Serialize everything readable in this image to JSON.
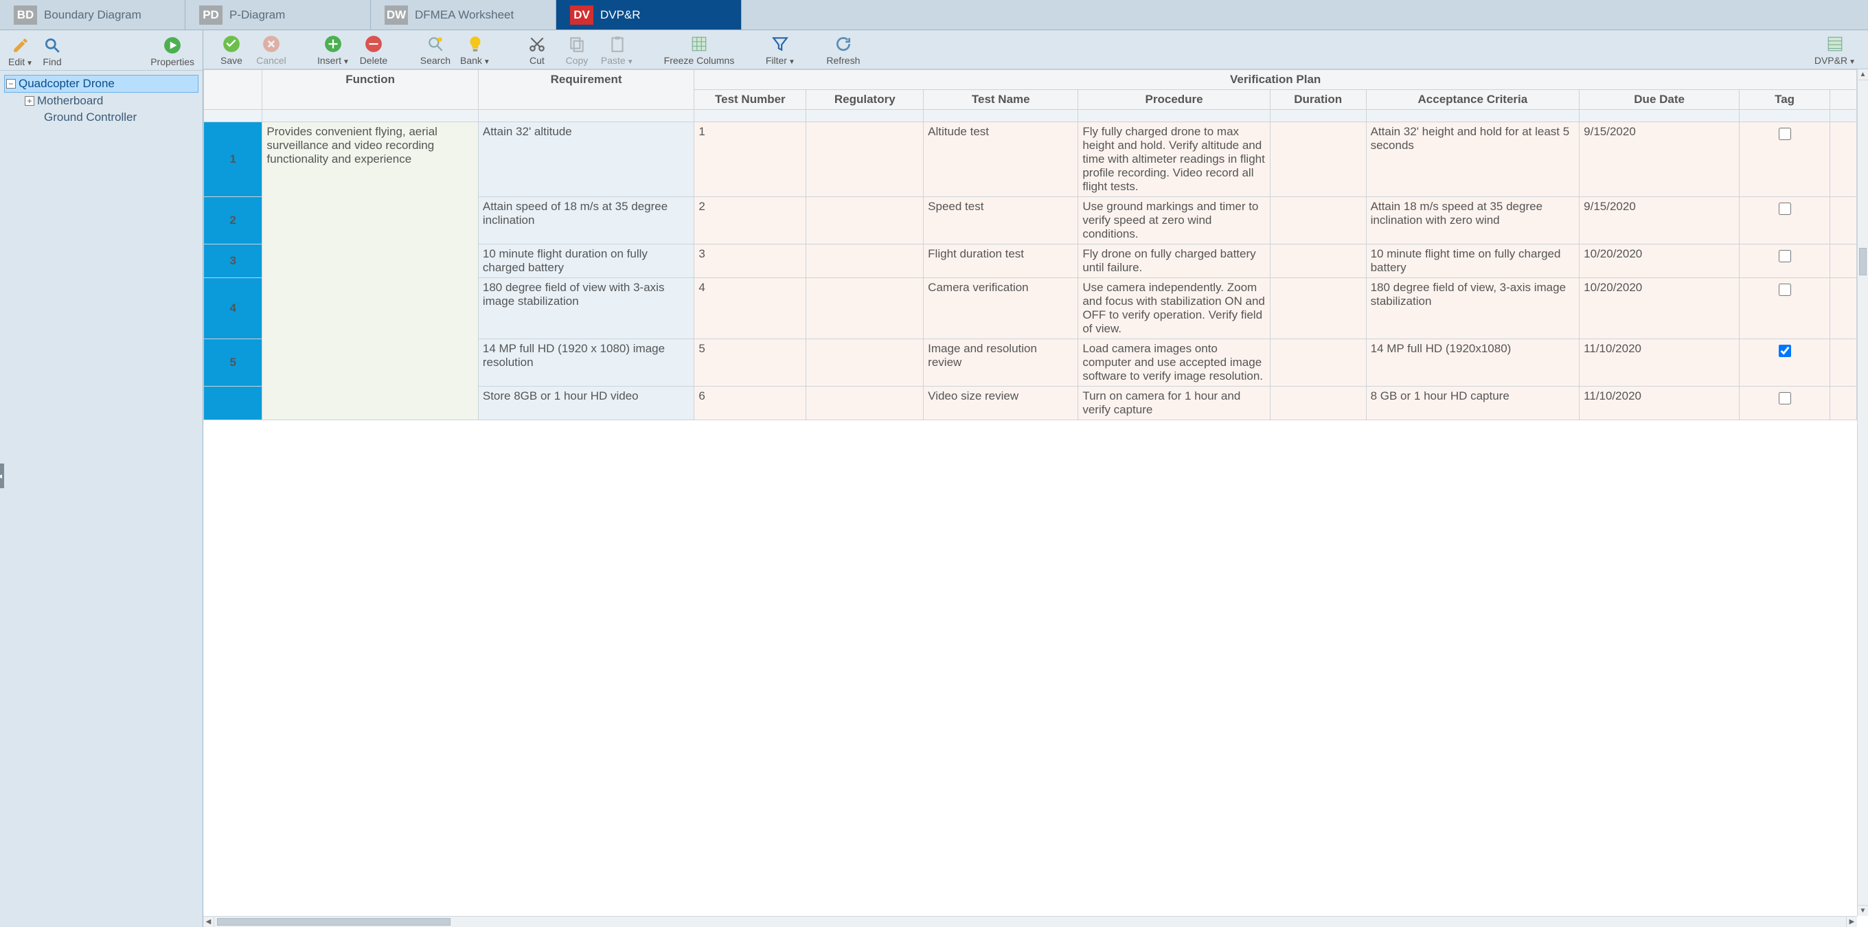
{
  "tabs": [
    {
      "badge": "BD",
      "label": "Boundary Diagram"
    },
    {
      "badge": "PD",
      "label": "P-Diagram"
    },
    {
      "badge": "DW",
      "label": "DFMEA Worksheet"
    },
    {
      "badge": "DV",
      "label": "DVP&R"
    }
  ],
  "leftToolbar": {
    "edit": "Edit",
    "find": "Find",
    "properties": "Properties"
  },
  "tree": {
    "root": "Quadcopter Drone",
    "child1": "Motherboard",
    "child2": "Ground Controller"
  },
  "rightToolbar": {
    "save": "Save",
    "cancel": "Cancel",
    "insert": "Insert",
    "delete": "Delete",
    "search": "Search",
    "bank": "Bank",
    "cut": "Cut",
    "copy": "Copy",
    "paste": "Paste",
    "freeze": "Freeze Columns",
    "filter": "Filter",
    "refresh": "Refresh",
    "dvpr": "DVP&R"
  },
  "headers": {
    "function": "Function",
    "requirement": "Requirement",
    "verification": "Verification Plan",
    "testNumber": "Test Number",
    "regulatory": "Regulatory",
    "testName": "Test Name",
    "procedure": "Procedure",
    "duration": "Duration",
    "acceptance": "Acceptance Criteria",
    "dueDate": "Due Date",
    "tag": "Tag"
  },
  "rows": [
    {
      "num": "1",
      "func": "Provides convenient flying, aerial surveillance and video recording functionality and experience",
      "req": "Attain 32' altitude",
      "tnum": "1",
      "reg": "",
      "tname": "Altitude test",
      "proc": "Fly fully charged drone to max height and hold. Verify altitude and time with altimeter readings in flight profile recording. Video record all flight tests.",
      "dur": "",
      "acc": "Attain 32' height and hold for at least 5 seconds",
      "due": "9/15/2020",
      "tag": false
    },
    {
      "num": "2",
      "func": "",
      "req": "Attain speed of 18 m/s at 35 degree inclination",
      "tnum": "2",
      "reg": "",
      "tname": "Speed test",
      "proc": "Use ground markings and timer to verify speed at zero wind conditions.",
      "dur": "",
      "acc": "Attain 18 m/s speed at 35 degree inclination with zero wind",
      "due": "9/15/2020",
      "tag": false
    },
    {
      "num": "3",
      "func": "",
      "req": "10 minute flight duration on fully charged battery",
      "tnum": "3",
      "reg": "",
      "tname": "Flight duration test",
      "proc": "Fly drone on fully charged battery until failure.",
      "dur": "",
      "acc": "10 minute flight time on fully charged battery",
      "due": "10/20/2020",
      "tag": false
    },
    {
      "num": "4",
      "func": "",
      "req": "180 degree field of view with 3-axis image stabilization",
      "tnum": "4",
      "reg": "",
      "tname": "Camera verification",
      "proc": "Use camera independently. Zoom and focus with stabilization ON and OFF to verify operation. Verify field of view.",
      "dur": "",
      "acc": "180 degree field of view, 3-axis image stabilization",
      "due": "10/20/2020",
      "tag": false
    },
    {
      "num": "5",
      "func": "",
      "req": "14 MP full HD (1920 x 1080) image resolution",
      "tnum": "5",
      "reg": "",
      "tname": "Image and resolution review",
      "proc": "Load camera images onto computer and use accepted image software to verify image resolution.",
      "dur": "",
      "acc": "14 MP full HD (1920x1080)",
      "due": "11/10/2020",
      "tag": true
    },
    {
      "num": "",
      "func": "",
      "req": "Store 8GB or 1 hour HD video",
      "tnum": "6",
      "reg": "",
      "tname": "Video size review",
      "proc": "Turn on camera for 1 hour and verify capture",
      "dur": "",
      "acc": "8 GB or 1 hour HD capture",
      "due": "11/10/2020",
      "tag": false
    }
  ]
}
